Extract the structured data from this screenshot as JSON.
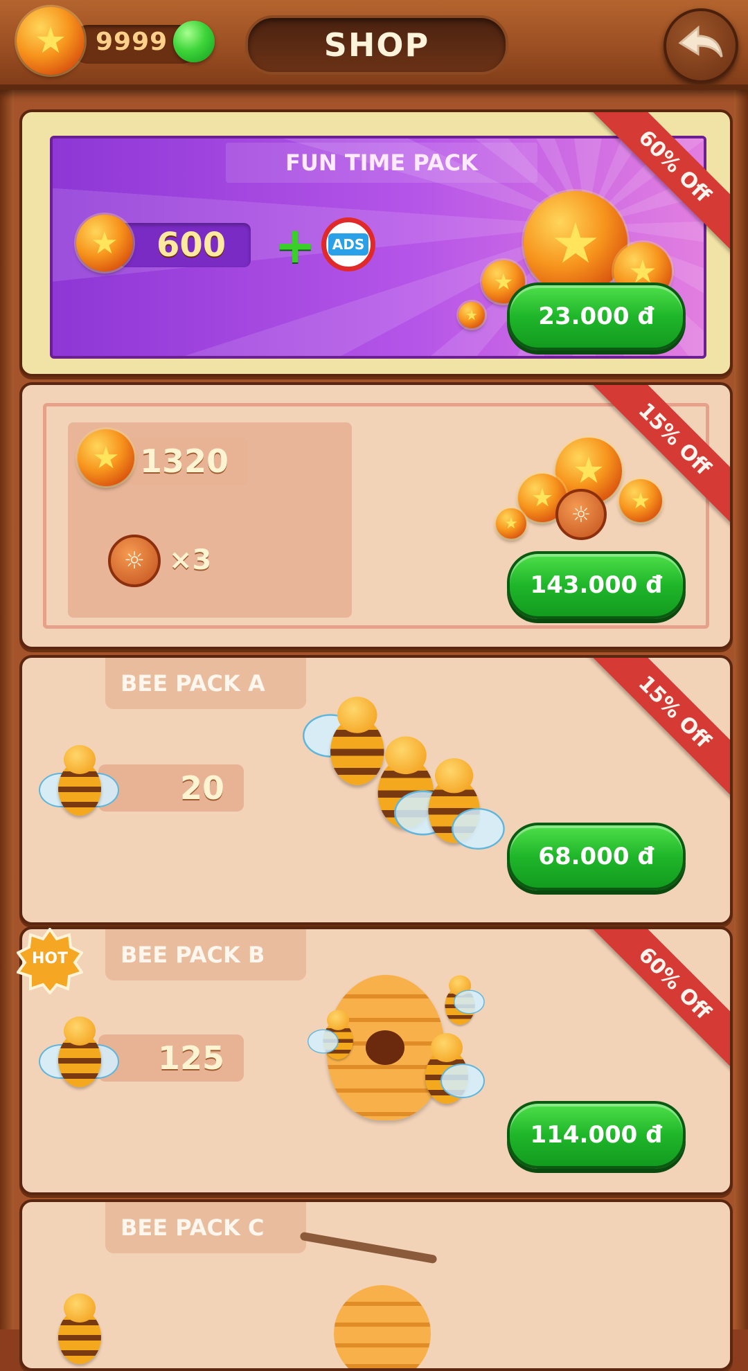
{
  "header": {
    "coins": "9999",
    "title": "SHOP",
    "back_icon": "back-arrow-icon",
    "coin_icon": "star-coin-icon",
    "gem_icon": "green-gem-icon"
  },
  "colors": {
    "accent_green": "#1fb62a",
    "ribbon_red": "#d63a35",
    "card_bg": "#f3d3b8",
    "promo_purple": "#9b3fe0"
  },
  "packs": [
    {
      "title": "FUN TIME PACK",
      "coins": "600",
      "plus": "+",
      "no_ads_label": "ADS",
      "discount": "60% Off",
      "price": "23.000 đ"
    },
    {
      "coins": "1320",
      "hint_count": "×3",
      "discount": "15% Off",
      "price": "143.000 đ"
    },
    {
      "title": "BEE PACK A",
      "bees": "20",
      "discount": "15% Off",
      "price": "68.000 đ"
    },
    {
      "title": "BEE PACK B",
      "bees": "125",
      "badge": "HOT",
      "discount": "60% Off",
      "price": "114.000 đ"
    },
    {
      "title": "BEE PACK C"
    }
  ]
}
